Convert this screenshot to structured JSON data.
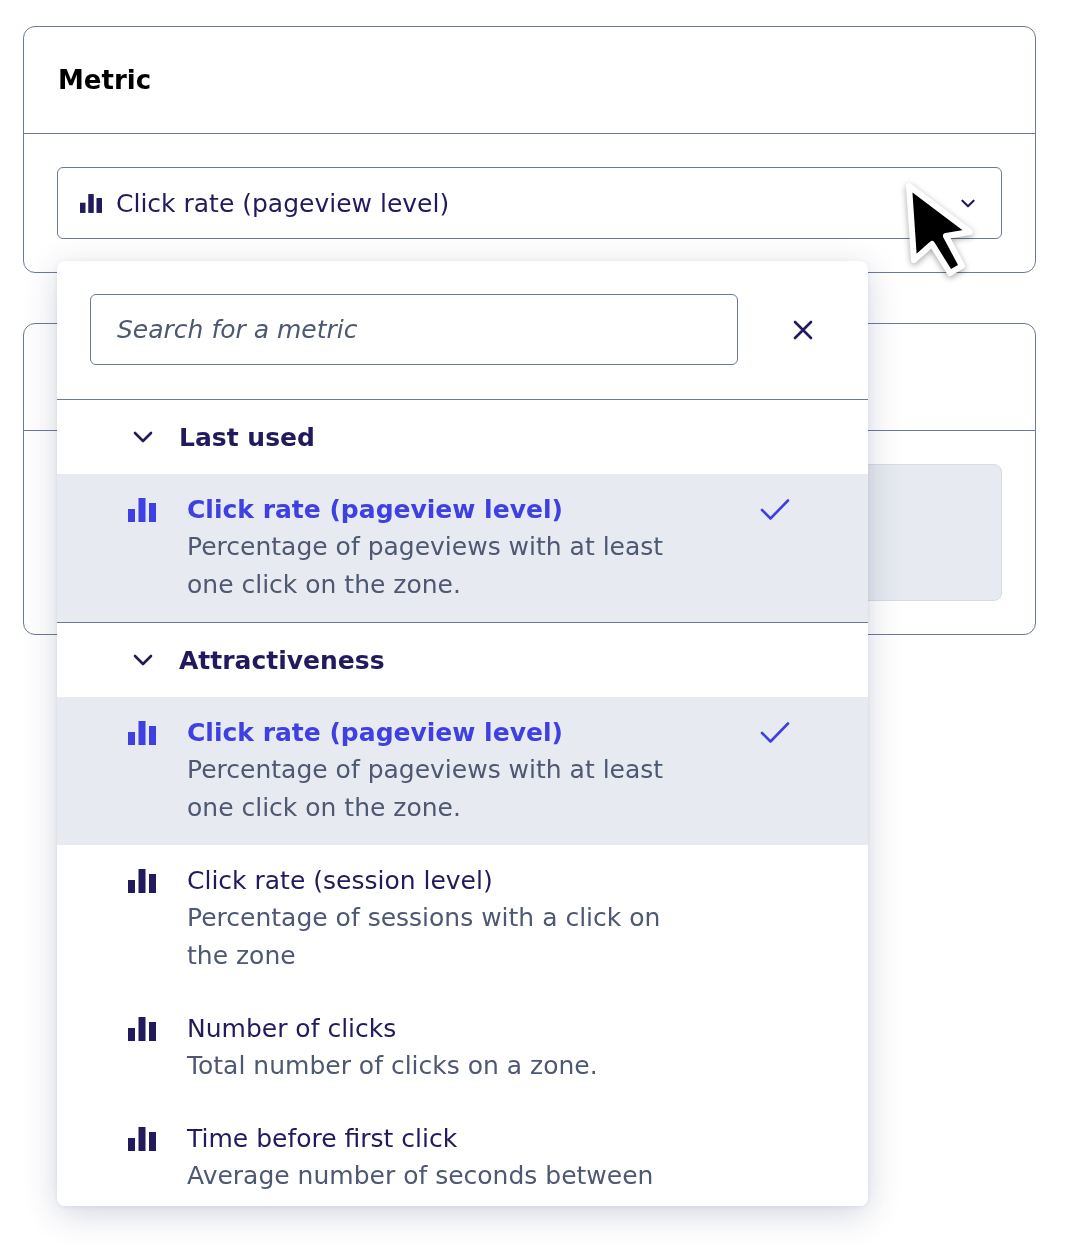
{
  "metric_card": {
    "title": "Metric",
    "select": {
      "value": "Click rate (pageview level)"
    }
  },
  "metric_dropdown": {
    "search": {
      "placeholder": "Search for a metric"
    },
    "groups": [
      {
        "label": "Last used",
        "expanded": true,
        "items": [
          {
            "title": "Click rate (pageview level)",
            "description": "Percentage of pageviews with at least one click on the zone.",
            "selected": true
          }
        ]
      },
      {
        "label": "Attractiveness",
        "expanded": true,
        "items": [
          {
            "title": "Click rate (pageview level)",
            "description": "Percentage of pageviews with at least one click on the zone.",
            "selected": true
          },
          {
            "title": "Click rate (session level)",
            "description": "Percentage of sessions with a click on the zone",
            "selected": false
          },
          {
            "title": "Number of clicks",
            "description": "Total number of clicks on a zone.",
            "selected": false
          },
          {
            "title": "Time before first click",
            "description": "Average number of seconds between",
            "selected": false
          }
        ]
      }
    ]
  }
}
